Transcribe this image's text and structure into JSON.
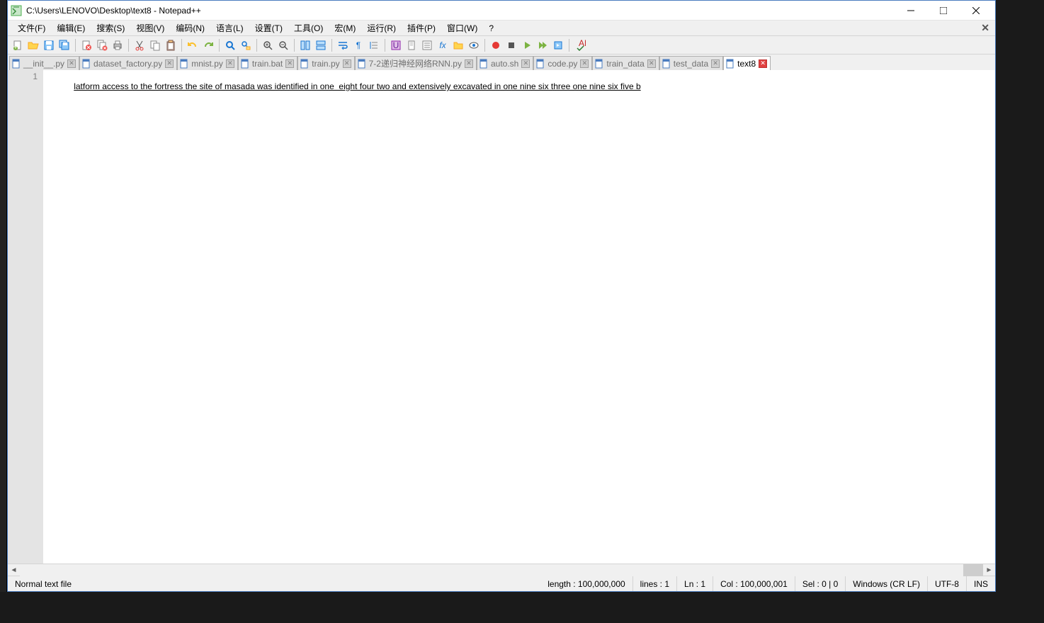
{
  "window": {
    "title": "C:\\Users\\LENOVO\\Desktop\\text8 - Notepad++"
  },
  "menu": {
    "file": "文件(F)",
    "edit": "编辑(E)",
    "search": "搜索(S)",
    "view": "视图(V)",
    "encoding": "编码(N)",
    "language": "语言(L)",
    "settings": "设置(T)",
    "tools": "工具(O)",
    "macro": "宏(M)",
    "run": "运行(R)",
    "plugins": "插件(P)",
    "window": "窗口(W)",
    "help": "?"
  },
  "tabs": [
    {
      "label": "__init__.py"
    },
    {
      "label": "dataset_factory.py"
    },
    {
      "label": "mnist.py"
    },
    {
      "label": "train.bat"
    },
    {
      "label": "train.py"
    },
    {
      "label": "7-2递归神经网络RNN.py"
    },
    {
      "label": "auto.sh"
    },
    {
      "label": "code.py"
    },
    {
      "label": "train_data"
    },
    {
      "label": "test_data"
    },
    {
      "label": "text8"
    }
  ],
  "active_tab_index": 10,
  "editor": {
    "line_number": "1",
    "content": "latform access to the fortress the site of masada was identified in one  eight four two and extensively excavated in one nine six three one nine six five b"
  },
  "status": {
    "filetype": "Normal text file",
    "length": "length : 100,000,000",
    "lines": "lines : 1",
    "ln": "Ln : 1",
    "col": "Col : 100,000,001",
    "sel": "Sel : 0 | 0",
    "eol": "Windows (CR LF)",
    "encoding": "UTF-8",
    "mode": "INS"
  }
}
